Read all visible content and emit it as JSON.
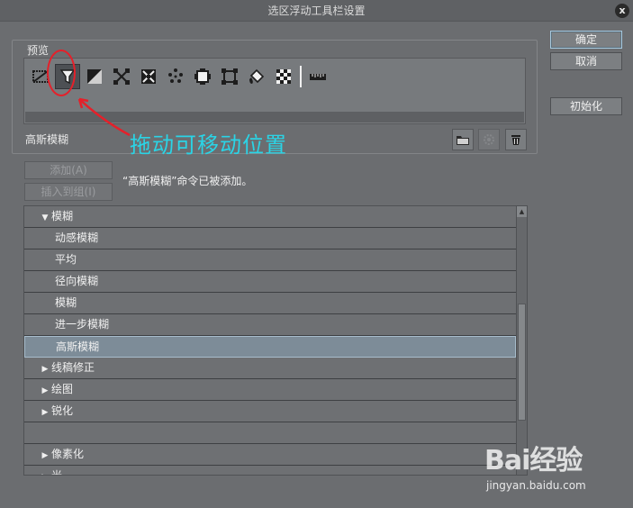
{
  "window": {
    "title": "选区浮动工具栏设置",
    "close_label": "x"
  },
  "preview": {
    "legend": "预览",
    "tools": [
      {
        "icon": "deselect-icon"
      },
      {
        "icon": "gaussian-blur-filter-icon",
        "selected": true
      },
      {
        "icon": "invert-selection-icon"
      },
      {
        "icon": "transform-icon"
      },
      {
        "icon": "mesh-transform-icon"
      },
      {
        "icon": "dots-pattern-icon"
      },
      {
        "icon": "expand-selection-icon"
      },
      {
        "icon": "shrink-selection-icon"
      },
      {
        "icon": "fill-bucket-icon"
      },
      {
        "icon": "checker-pattern-icon"
      },
      {
        "icon": "ruler-icon"
      }
    ],
    "selected_name": "高斯模糊"
  },
  "annotation": {
    "text": "拖动可移动位置",
    "color": "#2ad4e6"
  },
  "buttons": {
    "ok": "确定",
    "cancel": "取消",
    "reset": "初始化",
    "add": "添加(A)",
    "insert_group": "插入到组(I)"
  },
  "message": "“高斯模糊”命令已被添加。",
  "tree": [
    {
      "label": "模糊",
      "level": 0,
      "expanded": true
    },
    {
      "label": "动感模糊",
      "level": 1
    },
    {
      "label": "平均",
      "level": 1
    },
    {
      "label": "径向模糊",
      "level": 1
    },
    {
      "label": "模糊",
      "level": 1
    },
    {
      "label": "进一步模糊",
      "level": 1
    },
    {
      "label": "高斯模糊",
      "level": 1,
      "selected": true
    },
    {
      "label": "线稿修正",
      "level": 0,
      "expanded": false
    },
    {
      "label": "绘图",
      "level": 0,
      "expanded": false
    },
    {
      "label": "锐化",
      "level": 0,
      "expanded": false
    },
    {
      "label": "",
      "level": 0
    },
    {
      "label": "像素化",
      "level": 0,
      "expanded": false
    },
    {
      "label": "光",
      "level": 0,
      "expanded": false
    }
  ],
  "watermark": {
    "brand": "Bai经验",
    "url": "jingyan.baidu.com"
  },
  "colors": {
    "background": "#6b6d70",
    "selected_row": "#7d8c98",
    "highlight_red": "#e5202a"
  }
}
